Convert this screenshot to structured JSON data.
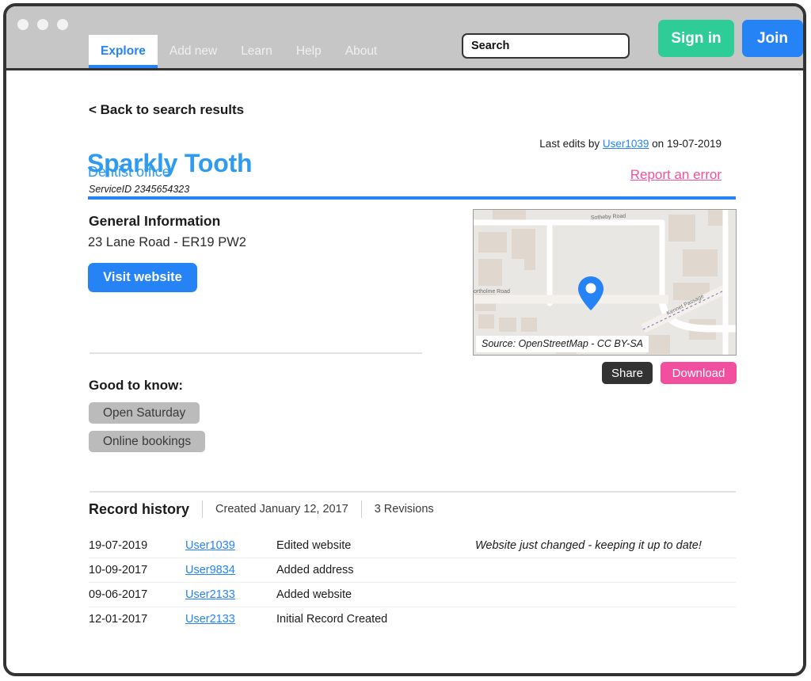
{
  "window": {
    "dots": [
      "close-dot",
      "minimize-dot",
      "maximize-dot"
    ]
  },
  "header": {
    "nav": [
      {
        "label": "Explore",
        "active": true
      },
      {
        "label": "Add new",
        "active": false
      },
      {
        "label": "Learn",
        "active": false
      },
      {
        "label": "Help",
        "active": false
      },
      {
        "label": "About",
        "active": false
      }
    ],
    "search": {
      "value": "Search",
      "placeholder": "Search"
    },
    "sign_in_label": "Sign in",
    "join_label": "Join",
    "colors": {
      "titlebar": "#c6c6c6",
      "sign_in": "#2ecc96",
      "join": "#2583f5",
      "active_tab_text": "#2583f5"
    }
  },
  "record": {
    "back_link": "< Back to search results",
    "title": "Sparkly Tooth",
    "subtitle": "Dentist office",
    "service_id": "ServiceID 2345654323",
    "last_edits_prefix": "Last edits by",
    "last_edits_user": "User1039",
    "last_edits_suffix": "on 19-07-2019",
    "report_error": "Report an error",
    "accent_color": "#2583f5",
    "title_color": "#2f9bf0",
    "report_color": "#f2509e"
  },
  "general_information": {
    "heading": "General Information",
    "address": "23 Lane Road - ER19 PW2",
    "visit_website_label": "Visit website"
  },
  "map": {
    "credit": "Source: OpenStreetMap - CC BY-SA",
    "street_labels": [
      "Sotheby Road",
      "Northolme Road",
      "Kennet Passage"
    ],
    "pin_color": "#2583f5",
    "share_label": "Share",
    "download_label": "Download",
    "share_color": "#333333",
    "download_color": "#f2509e"
  },
  "good_to_know": {
    "heading": "Good to know:",
    "tags": [
      "Open Saturday",
      "Online bookings"
    ]
  },
  "record_history": {
    "heading": "Record history",
    "created": "Created January 12, 2017",
    "revisions": "3 Revisions",
    "rows": [
      {
        "date": "19-07-2019",
        "user": "User1039",
        "action": "Edited website",
        "note": "Website just changed - keeping it up to date!"
      },
      {
        "date": "10-09-2017",
        "user": "User9834",
        "action": "Added address",
        "note": ""
      },
      {
        "date": "09-06-2017",
        "user": "User2133",
        "action": "Added website",
        "note": ""
      },
      {
        "date": "12-01-2017",
        "user": "User2133",
        "action": "Initial Record Created",
        "note": ""
      }
    ]
  }
}
